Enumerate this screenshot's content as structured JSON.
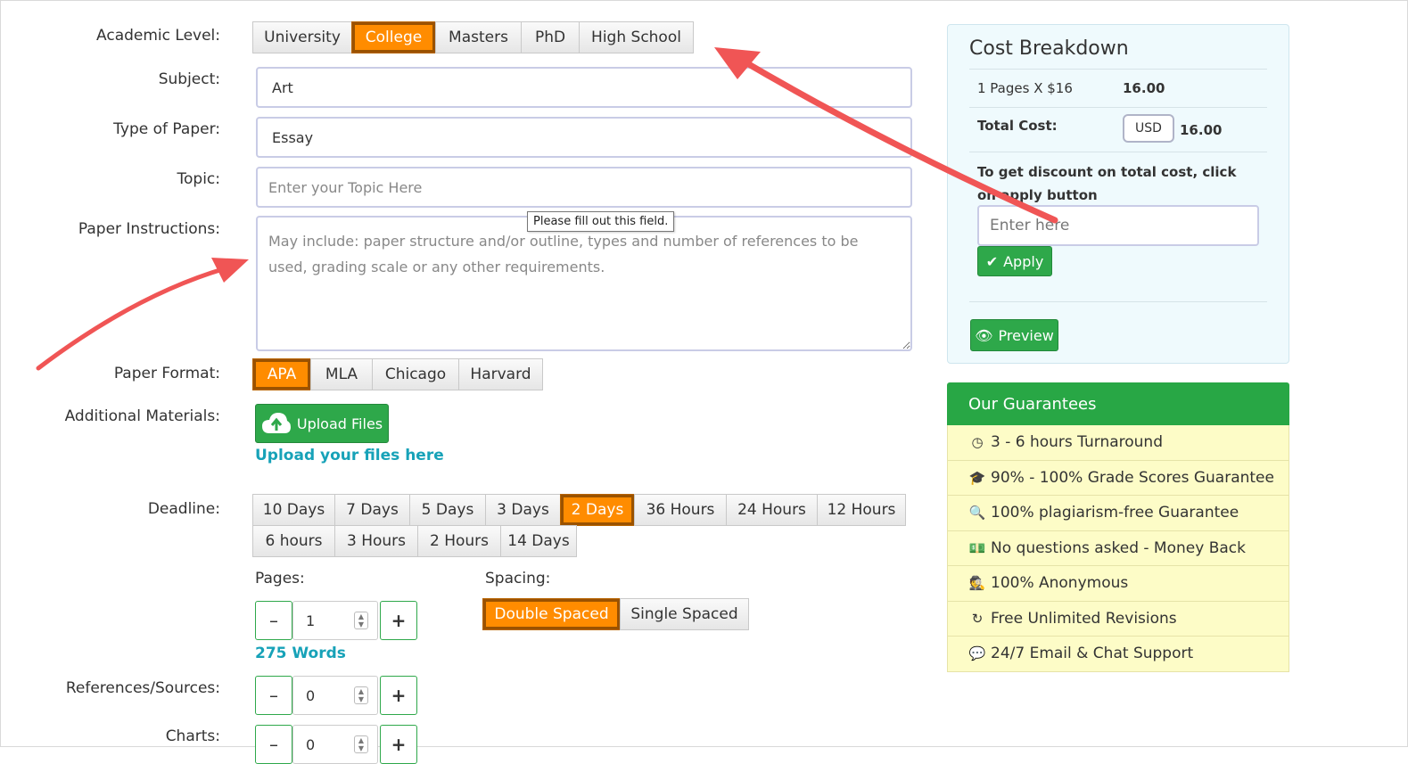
{
  "form": {
    "academic_level": {
      "label": "Academic Level:",
      "options": [
        "University",
        "College",
        "Masters",
        "PhD",
        "High School"
      ],
      "selected": "College"
    },
    "subject": {
      "label": "Subject:",
      "value": "Art"
    },
    "type_of_paper": {
      "label": "Type of Paper:",
      "value": "Essay"
    },
    "topic": {
      "label": "Topic:",
      "placeholder": "Enter your Topic Here"
    },
    "instructions": {
      "label": "Paper Instructions:",
      "placeholder": "May include: paper structure and/or outline, types and number of references to be used, grading scale or any other requirements.",
      "tooltip": "Please fill out this field."
    },
    "paper_format": {
      "label": "Paper Format:",
      "options": [
        "APA",
        "MLA",
        "Chicago",
        "Harvard"
      ],
      "selected": "APA"
    },
    "additional_materials": {
      "label": "Additional Materials:",
      "upload_button": "Upload Files",
      "upload_link": "Upload your files here"
    },
    "deadline": {
      "label": "Deadline:",
      "row1": [
        "10 Days",
        "7 Days",
        "5 Days",
        "3 Days",
        "2 Days",
        "36 Hours",
        "24 Hours",
        "12 Hours"
      ],
      "row2": [
        "6 hours",
        "3 Hours",
        "2 Hours",
        "14 Days"
      ],
      "selected": "2 Days"
    },
    "pages": {
      "label": "Pages:",
      "value": "1",
      "words": "275 Words",
      "minus": "–",
      "plus": "+"
    },
    "spacing": {
      "label": "Spacing:",
      "options": [
        "Double Spaced",
        "Single Spaced"
      ],
      "selected": "Double Spaced"
    },
    "references": {
      "label": "References/Sources:",
      "value": "0"
    },
    "charts": {
      "label": "Charts:",
      "value": "0"
    }
  },
  "cost": {
    "title": "Cost Breakdown",
    "line_label": "1 Pages X $16",
    "line_value": "16.00",
    "total_label": "Total Cost:",
    "currency": "USD",
    "total_value": "16.00",
    "discount_text": "To get discount on total cost, click on apply button",
    "discount_placeholder": "Enter here",
    "apply_label": "Apply",
    "preview_label": "Preview"
  },
  "guarantees": {
    "title": "Our Guarantees",
    "items": [
      {
        "icon": "clock-icon",
        "glyph": "◷",
        "text": "3 - 6 hours Turnaround"
      },
      {
        "icon": "graduation-cap-icon",
        "glyph": "🎓",
        "text": "90% - 100% Grade Scores Guarantee"
      },
      {
        "icon": "search-icon",
        "glyph": "🔍",
        "text": "100% plagiarism-free Guarantee"
      },
      {
        "icon": "money-icon",
        "glyph": "💵",
        "text": "No questions asked - Money Back"
      },
      {
        "icon": "user-secret-icon",
        "glyph": "🕵",
        "text": "100% Anonymous"
      },
      {
        "icon": "refresh-icon",
        "glyph": "↻",
        "text": "Free Unlimited Revisions"
      },
      {
        "icon": "comments-icon",
        "glyph": "💬",
        "text": "24/7 Email & Chat Support"
      }
    ]
  },
  "colors": {
    "accent": "#ff8c00",
    "green": "#28a745",
    "link": "#17a2b8",
    "arrow": "#f05555"
  }
}
